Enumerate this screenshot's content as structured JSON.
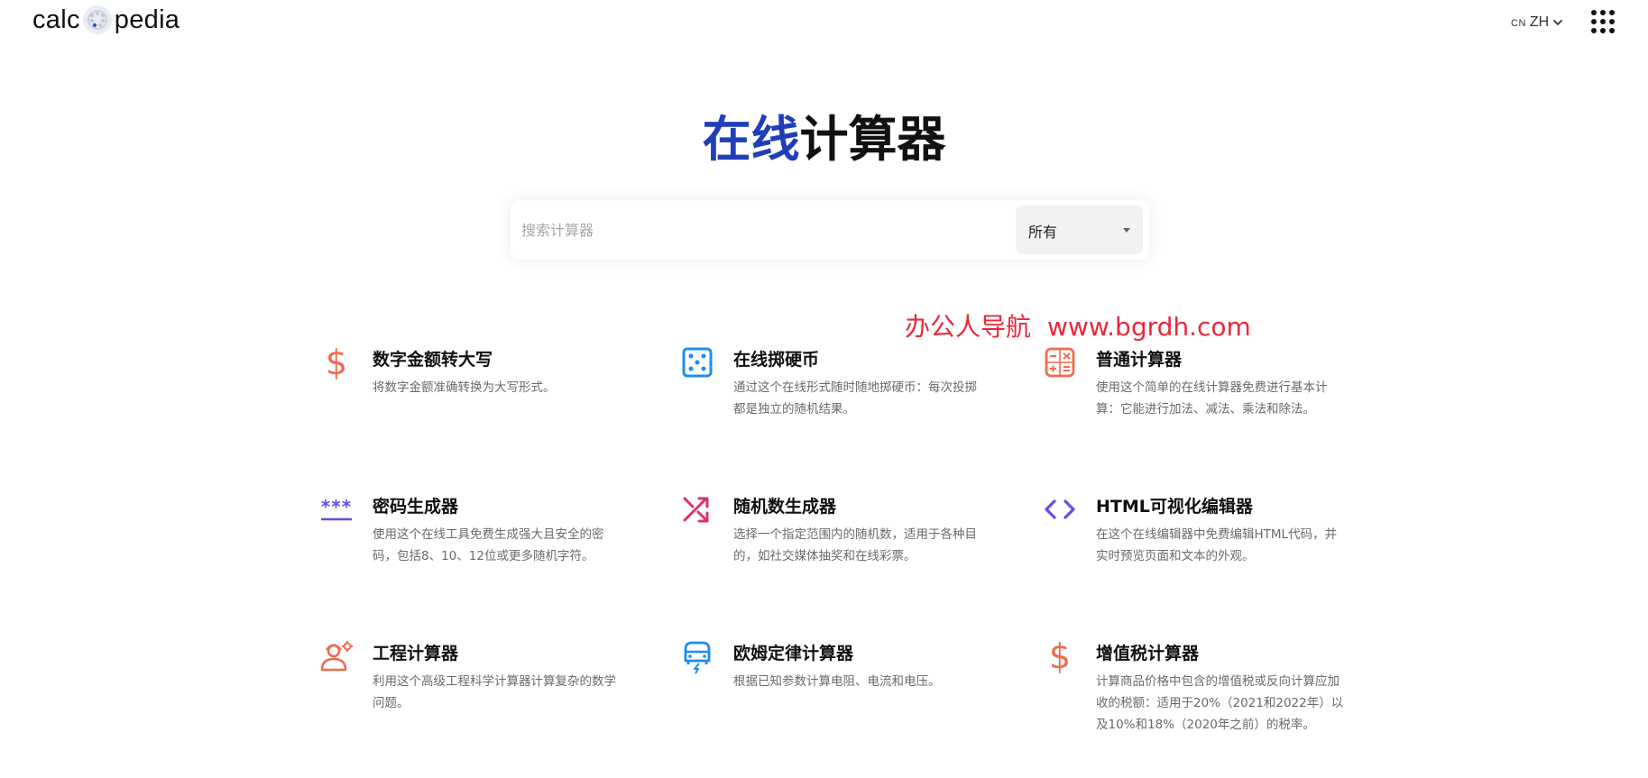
{
  "header": {
    "logo_pre": "calc",
    "logo_post": "pedia",
    "lang_flag": "CN",
    "lang_code": "ZH",
    "apps_icon": "grid-icon"
  },
  "hero": {
    "title_accent": "在线",
    "title_rest": "计算器"
  },
  "search": {
    "placeholder": "搜索计算器",
    "value": "",
    "category": "所有"
  },
  "watermark": {
    "left": "办公人导航",
    "right": "www.bgrdh.com"
  },
  "colors": {
    "accent": "#1f3fb8",
    "watermark": "#e8293a",
    "orange": "#f06b4f",
    "blue": "#1d8cf0",
    "purple": "#6b48e8",
    "magenta": "#e0306a"
  },
  "calculators": [
    {
      "title": "数字金额转大写",
      "desc": "将数字金额准确转换为大写形式。",
      "icon": "dollar-icon"
    },
    {
      "title": "在线掷硬币",
      "desc": "通过这个在线形式随时随地掷硬币：每次投掷都是独立的随机结果。",
      "icon": "dice-icon"
    },
    {
      "title": "普通计算器",
      "desc": "使用这个简单的在线计算器免费进行基本计算：它能进行加法、减法、乘法和除法。",
      "icon": "calculator-icon"
    },
    {
      "title": "密码生成器",
      "desc": "使用这个在线工具免费生成强大且安全的密码，包括8、10、12位或更多随机字符。",
      "icon": "password-icon"
    },
    {
      "title": "随机数生成器",
      "desc": "选择一个指定范围内的随机数，适用于各种目的，如社交媒体抽奖和在线彩票。",
      "icon": "shuffle-icon"
    },
    {
      "title": "HTML可视化编辑器",
      "desc": "在这个在线编辑器中免费编辑HTML代码，并实时预览页面和文本的外观。",
      "icon": "code-icon"
    },
    {
      "title": "工程计算器",
      "desc": "利用这个高级工程科学计算器计算复杂的数学问题。",
      "icon": "engineer-icon"
    },
    {
      "title": "欧姆定律计算器",
      "desc": "根据已知参数计算电阻、电流和电压。",
      "icon": "electric-car-icon"
    },
    {
      "title": "增值税计算器",
      "desc": "计算商品价格中包含的增值税或反向计算应加收的税额：适用于20%（2021和2022年）以及10%和18%（2020年之前）的税率。",
      "icon": "dollar-icon"
    }
  ]
}
